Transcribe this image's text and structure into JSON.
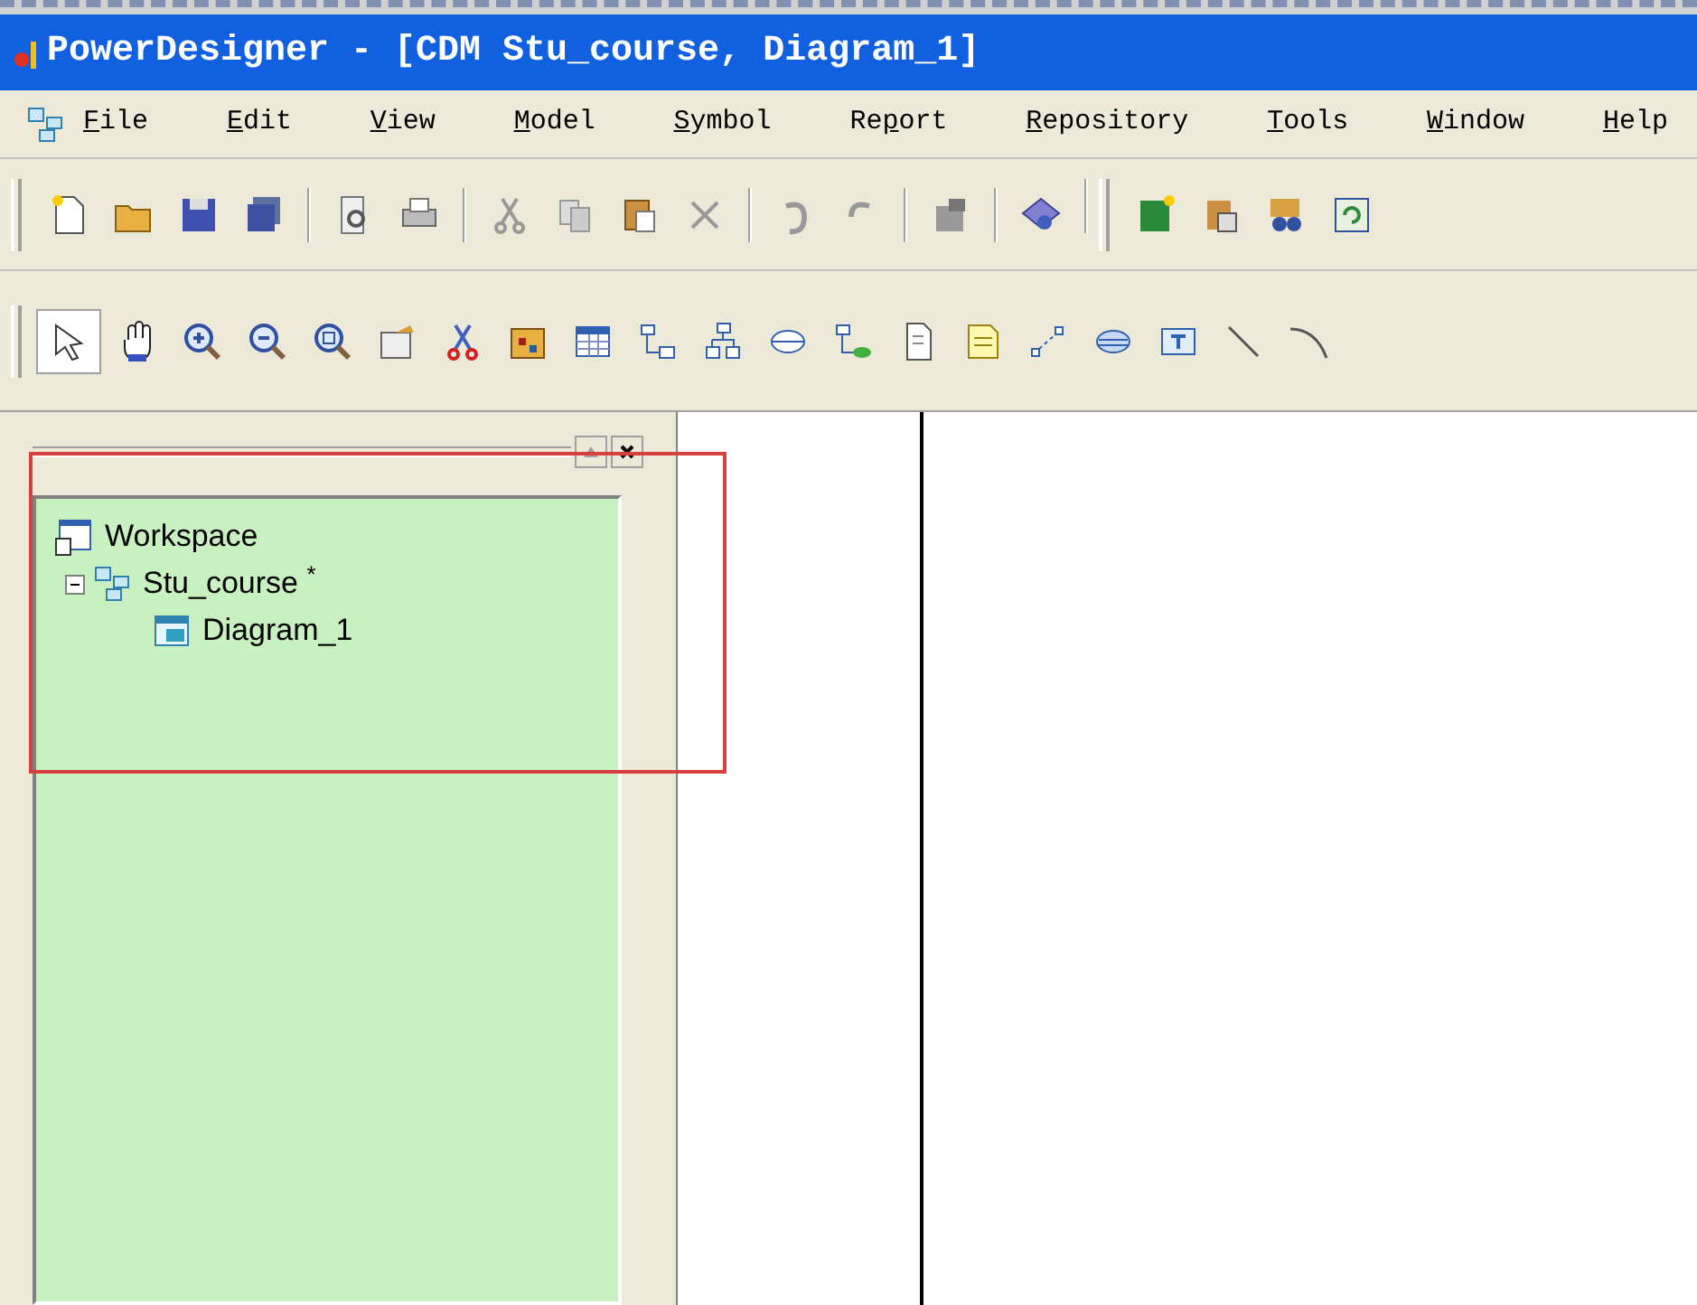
{
  "window": {
    "title": "PowerDesigner - [CDM Stu_course, Diagram_1]"
  },
  "menu": [
    {
      "key": "F",
      "after": "ile"
    },
    {
      "key": "E",
      "after": "dit"
    },
    {
      "key": "V",
      "after": "iew"
    },
    {
      "key": "M",
      "after": "odel"
    },
    {
      "key": "S",
      "after": "ymbol"
    },
    {
      "before": "Re",
      "key": "p",
      "after": "ort"
    },
    {
      "key": "R",
      "after": "epository"
    },
    {
      "key": "T",
      "after": "ools"
    },
    {
      "key": "W",
      "after": "indow"
    },
    {
      "key": "H",
      "after": "elp"
    }
  ],
  "toolbar_2": {
    "pointer_selected": true
  },
  "browser": {
    "tree": [
      {
        "label": "Workspace",
        "kind": "workspace",
        "children": [
          {
            "label": "Stu_course $^{*}$",
            "kind": "model",
            "expanded": true,
            "children": [
              {
                "label": "Diagram_1",
                "kind": "diagram"
              }
            ]
          }
        ]
      }
    ]
  }
}
